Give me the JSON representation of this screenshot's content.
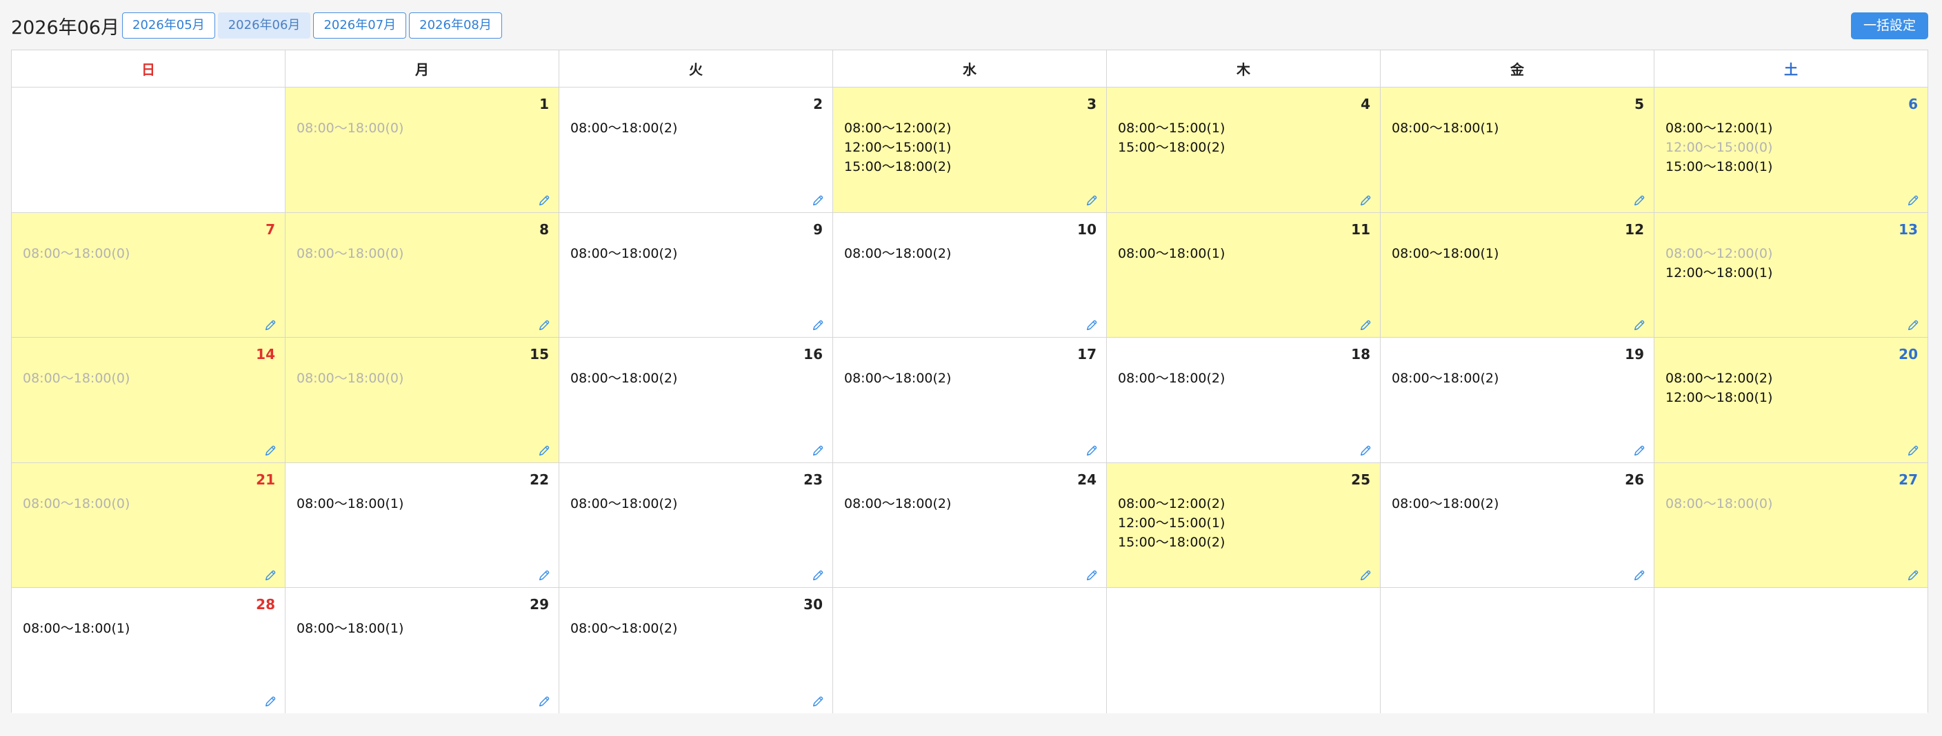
{
  "toolbar": {
    "title": "2026年06月",
    "months": [
      "2026年05月",
      "2026年06月",
      "2026年07月",
      "2026年08月"
    ],
    "active_month": "2026年06月",
    "bulk_label": "一括設定"
  },
  "calendar": {
    "weekdays": [
      "日",
      "月",
      "火",
      "水",
      "木",
      "金",
      "土"
    ],
    "weeks": [
      [
        null,
        {
          "day": "1",
          "hl": true,
          "slots": [
            {
              "t": "08:00〜18:00(0)",
              "dim": true
            }
          ]
        },
        {
          "day": "2",
          "hl": false,
          "slots": [
            {
              "t": "08:00〜18:00(2)",
              "dim": false
            }
          ]
        },
        {
          "day": "3",
          "hl": true,
          "slots": [
            {
              "t": "08:00〜12:00(2)",
              "dim": false
            },
            {
              "t": "12:00〜15:00(1)",
              "dim": false
            },
            {
              "t": "15:00〜18:00(2)",
              "dim": false
            }
          ]
        },
        {
          "day": "4",
          "hl": true,
          "slots": [
            {
              "t": "08:00〜15:00(1)",
              "dim": false
            },
            {
              "t": "15:00〜18:00(2)",
              "dim": false
            }
          ]
        },
        {
          "day": "5",
          "hl": true,
          "slots": [
            {
              "t": "08:00〜18:00(1)",
              "dim": false
            }
          ]
        },
        {
          "day": "6",
          "hl": true,
          "slots": [
            {
              "t": "08:00〜12:00(1)",
              "dim": false
            },
            {
              "t": "12:00〜15:00(0)",
              "dim": true
            },
            {
              "t": "15:00〜18:00(1)",
              "dim": false
            }
          ]
        }
      ],
      [
        {
          "day": "7",
          "hl": true,
          "slots": [
            {
              "t": "08:00〜18:00(0)",
              "dim": true
            }
          ]
        },
        {
          "day": "8",
          "hl": true,
          "slots": [
            {
              "t": "08:00〜18:00(0)",
              "dim": true
            }
          ]
        },
        {
          "day": "9",
          "hl": false,
          "slots": [
            {
              "t": "08:00〜18:00(2)",
              "dim": false
            }
          ]
        },
        {
          "day": "10",
          "hl": false,
          "slots": [
            {
              "t": "08:00〜18:00(2)",
              "dim": false
            }
          ]
        },
        {
          "day": "11",
          "hl": true,
          "slots": [
            {
              "t": "08:00〜18:00(1)",
              "dim": false
            }
          ]
        },
        {
          "day": "12",
          "hl": true,
          "slots": [
            {
              "t": "08:00〜18:00(1)",
              "dim": false
            }
          ]
        },
        {
          "day": "13",
          "hl": true,
          "slots": [
            {
              "t": "08:00〜12:00(0)",
              "dim": true
            },
            {
              "t": "12:00〜18:00(1)",
              "dim": false
            }
          ]
        }
      ],
      [
        {
          "day": "14",
          "hl": true,
          "slots": [
            {
              "t": "08:00〜18:00(0)",
              "dim": true
            }
          ]
        },
        {
          "day": "15",
          "hl": true,
          "slots": [
            {
              "t": "08:00〜18:00(0)",
              "dim": true
            }
          ]
        },
        {
          "day": "16",
          "hl": false,
          "slots": [
            {
              "t": "08:00〜18:00(2)",
              "dim": false
            }
          ]
        },
        {
          "day": "17",
          "hl": false,
          "slots": [
            {
              "t": "08:00〜18:00(2)",
              "dim": false
            }
          ]
        },
        {
          "day": "18",
          "hl": false,
          "slots": [
            {
              "t": "08:00〜18:00(2)",
              "dim": false
            }
          ]
        },
        {
          "day": "19",
          "hl": false,
          "slots": [
            {
              "t": "08:00〜18:00(2)",
              "dim": false
            }
          ]
        },
        {
          "day": "20",
          "hl": true,
          "slots": [
            {
              "t": "08:00〜12:00(2)",
              "dim": false
            },
            {
              "t": "12:00〜18:00(1)",
              "dim": false
            }
          ]
        }
      ],
      [
        {
          "day": "21",
          "hl": true,
          "slots": [
            {
              "t": "08:00〜18:00(0)",
              "dim": true
            }
          ]
        },
        {
          "day": "22",
          "hl": false,
          "slots": [
            {
              "t": "08:00〜18:00(1)",
              "dim": false
            }
          ]
        },
        {
          "day": "23",
          "hl": false,
          "slots": [
            {
              "t": "08:00〜18:00(2)",
              "dim": false
            }
          ]
        },
        {
          "day": "24",
          "hl": false,
          "slots": [
            {
              "t": "08:00〜18:00(2)",
              "dim": false
            }
          ]
        },
        {
          "day": "25",
          "hl": true,
          "slots": [
            {
              "t": "08:00〜12:00(2)",
              "dim": false
            },
            {
              "t": "12:00〜15:00(1)",
              "dim": false
            },
            {
              "t": "15:00〜18:00(2)",
              "dim": false
            }
          ]
        },
        {
          "day": "26",
          "hl": false,
          "slots": [
            {
              "t": "08:00〜18:00(2)",
              "dim": false
            }
          ]
        },
        {
          "day": "27",
          "hl": true,
          "slots": [
            {
              "t": "08:00〜18:00(0)",
              "dim": true
            }
          ]
        }
      ],
      [
        {
          "day": "28",
          "hl": false,
          "slots": [
            {
              "t": "08:00〜18:00(1)",
              "dim": false
            }
          ]
        },
        {
          "day": "29",
          "hl": false,
          "slots": [
            {
              "t": "08:00〜18:00(1)",
              "dim": false
            }
          ]
        },
        {
          "day": "30",
          "hl": false,
          "slots": [
            {
              "t": "08:00〜18:00(2)",
              "dim": false
            }
          ]
        },
        null,
        null,
        null,
        null
      ]
    ]
  },
  "colors": {
    "highlight": "#fffcab",
    "sunday": "#e0322d",
    "saturday": "#2e6fd1",
    "accent": "#3b8fe8",
    "dim_text": "#b3b3b3"
  },
  "icons": {
    "edit": "pencil-icon"
  }
}
